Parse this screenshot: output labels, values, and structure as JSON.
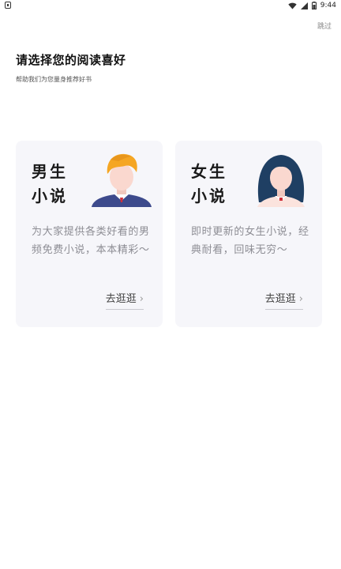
{
  "status_bar": {
    "time": "9:44"
  },
  "header": {
    "skip_label": "跳过",
    "title": "请选择您的阅读喜好",
    "subtitle": "帮助我们为您量身推荐好书"
  },
  "cards": [
    {
      "id": "male",
      "title_line1": "男生",
      "title_line2": "小说",
      "description": "为大家提供各类好看的男频免费小说，本本精彩～",
      "button_label": "去逛逛",
      "illustration": "male-avatar-icon"
    },
    {
      "id": "female",
      "title_line1": "女生",
      "title_line2": "小说",
      "description": "即时更新的女生小说，经典耐看，回味无穷～",
      "button_label": "去逛逛",
      "illustration": "female-avatar-icon"
    }
  ],
  "colors": {
    "card_background": "#f6f6fa",
    "title_text": "#111111",
    "description_text": "#8d8d94",
    "male_hair": "#f5a623",
    "male_shirt": "#3d4a8c",
    "female_hair": "#1f3f63",
    "tie": "#d0303a"
  }
}
